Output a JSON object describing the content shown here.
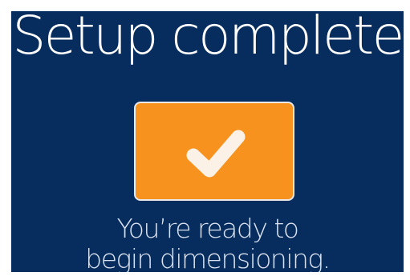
{
  "screen": {
    "title": "Setup complete",
    "status_icon": "checkmark-icon",
    "message_line1": "You’re ready to",
    "message_line2": "begin dimensioning.",
    "colors": {
      "background": "#072c5e",
      "tile": "#f7921e",
      "tile_border": "#e9e9ea",
      "check": "#fbf1e6",
      "title_text": "#ffffff",
      "message_text": "#d9e2ee"
    }
  }
}
